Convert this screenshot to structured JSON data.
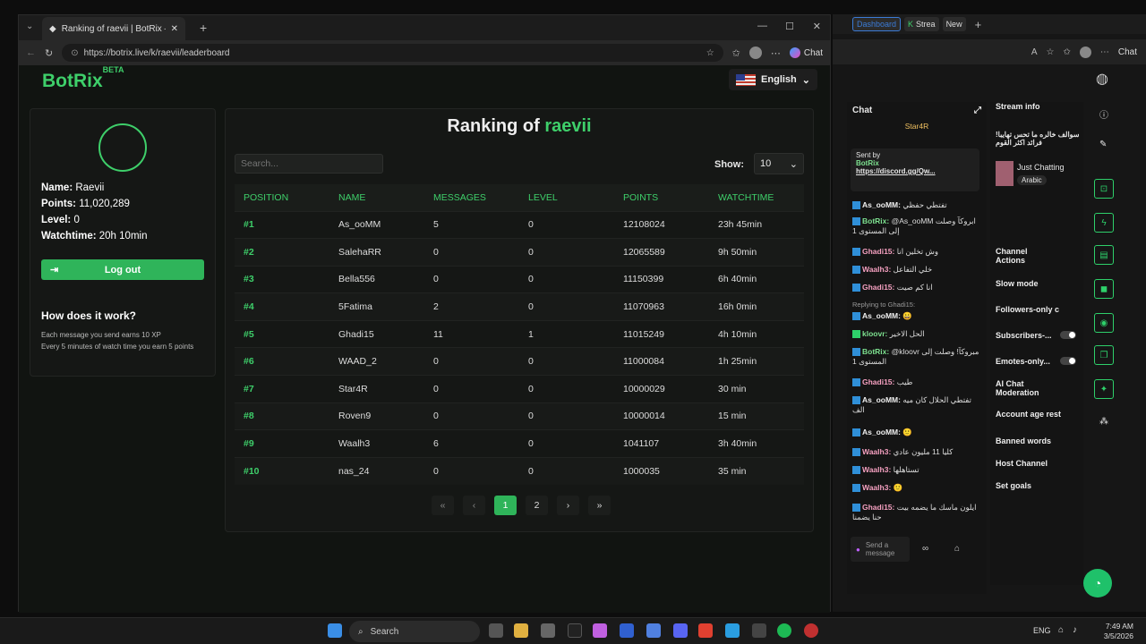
{
  "browser": {
    "tab_title": "Ranking of raevii | BotRix — Cloud",
    "url": "https://botrix.live/k/raevii/leaderboard",
    "chat_label": "Chat"
  },
  "site": {
    "logo": "BotRix",
    "logo_sup": "BETA",
    "language": "English"
  },
  "profile": {
    "name_label": "Name:",
    "name": "Raevii",
    "points_label": "Points:",
    "points": "11,020,289",
    "level_label": "Level:",
    "level": "0",
    "watch_label": "Watchtime:",
    "watchtime": "20h 10min",
    "logout": "Log out",
    "how_title": "How does it work?",
    "note1": "Each message you send earns 10 XP",
    "note2": "Every 5 minutes of watch time you earn 5 points"
  },
  "ranking": {
    "title_prefix": "Ranking of",
    "username": "raevii",
    "search_placeholder": "Search...",
    "show_label": "Show:",
    "show_value": "10",
    "columns": [
      "POSITION",
      "NAME",
      "MESSAGES",
      "LEVEL",
      "POINTS",
      "WATCHTIME"
    ],
    "rows": [
      [
        "#1",
        "As_ooMM",
        "5",
        "0",
        "12108024",
        "23h 45min"
      ],
      [
        "#2",
        "SalehaRR",
        "0",
        "0",
        "12065589",
        "9h 50min"
      ],
      [
        "#3",
        "Bella556",
        "0",
        "0",
        "11150399",
        "6h 40min"
      ],
      [
        "#4",
        "5Fatima",
        "2",
        "0",
        "11070963",
        "16h 0min"
      ],
      [
        "#5",
        "Ghadi15",
        "11",
        "1",
        "11015249",
        "4h 10min"
      ],
      [
        "#6",
        "WAAD_2",
        "0",
        "0",
        "11000084",
        "1h 25min"
      ],
      [
        "#7",
        "Star4R",
        "0",
        "0",
        "10000029",
        "30 min"
      ],
      [
        "#8",
        "Roven9",
        "0",
        "0",
        "10000014",
        "15 min"
      ],
      [
        "#9",
        "Waalh3",
        "6",
        "0",
        "1041107",
        "3h 40min"
      ],
      [
        "#10",
        "nas_24",
        "0",
        "0",
        "1000035",
        "35 min"
      ]
    ],
    "pages": [
      "1",
      "2"
    ]
  },
  "right": {
    "tabs": [
      "Dashboard",
      "Strea",
      "New"
    ],
    "chat_title": "Chat",
    "pinned_user": "Star4R",
    "sent_by": "Sent by",
    "pin_bot": "BotRix",
    "pin_link": "https://discord.gg/Qw...",
    "messages": [
      {
        "user": "As_ooMM:",
        "text": "تفتطي حفظي"
      },
      {
        "user": "BotRix:",
        "text": "@As_ooMM ابروكآ وصلت إلى المستوى 1"
      },
      {
        "user": "Ghadi15:",
        "text": "وش تخلين انا"
      },
      {
        "user": "Waalh3:",
        "text": "خلي التفاعل"
      },
      {
        "user": "Ghadi15:",
        "text": "انا كم صيت"
      },
      {
        "user": "As_ooMM:",
        "text": ""
      },
      {
        "user": "kloovr:",
        "text": "الحل الاخير"
      },
      {
        "user": "BotRix:",
        "text": "@kloovr مبروكآ! وصلت إلى المستوى 1"
      },
      {
        "user": "Ghadi15:",
        "text": "طيب"
      },
      {
        "user": "As_ooMM:",
        "text": "تفتطي الحلال كان ميه الف"
      },
      {
        "user": "As_ooMM:",
        "text": ""
      },
      {
        "user": "Waalh3:",
        "text": "كليا 11 مليون عادي"
      },
      {
        "user": "Waalh3:",
        "text": "تستاهلها"
      },
      {
        "user": "Waalh3:",
        "text": ""
      },
      {
        "user": "Ghadi15:",
        "text": "ايلون ماسك ما يضمه بيت حنا يضمنا"
      }
    ],
    "replying": "Replying to Ghadi15:",
    "send_placeholder": "Send a message",
    "stream_info": "Stream info",
    "stream_text": "سوالف خالره ما تحس تهايبا! فرائد اكثر القوم",
    "just_chatting": "Just Chatting",
    "arabic": "Arabic",
    "channel_actions": "Channel Actions",
    "actions": [
      "Slow mode",
      "Followers-only c",
      "Subscribers-...",
      "Emotes-only...",
      "AI Chat Moderation",
      "Account age rest",
      "Banned words",
      "Host Channel",
      "Set goals"
    ]
  },
  "taskbar": {
    "search": "Search",
    "lang": "ENG",
    "time": "7:49 AM",
    "date": "3/5/2026"
  }
}
